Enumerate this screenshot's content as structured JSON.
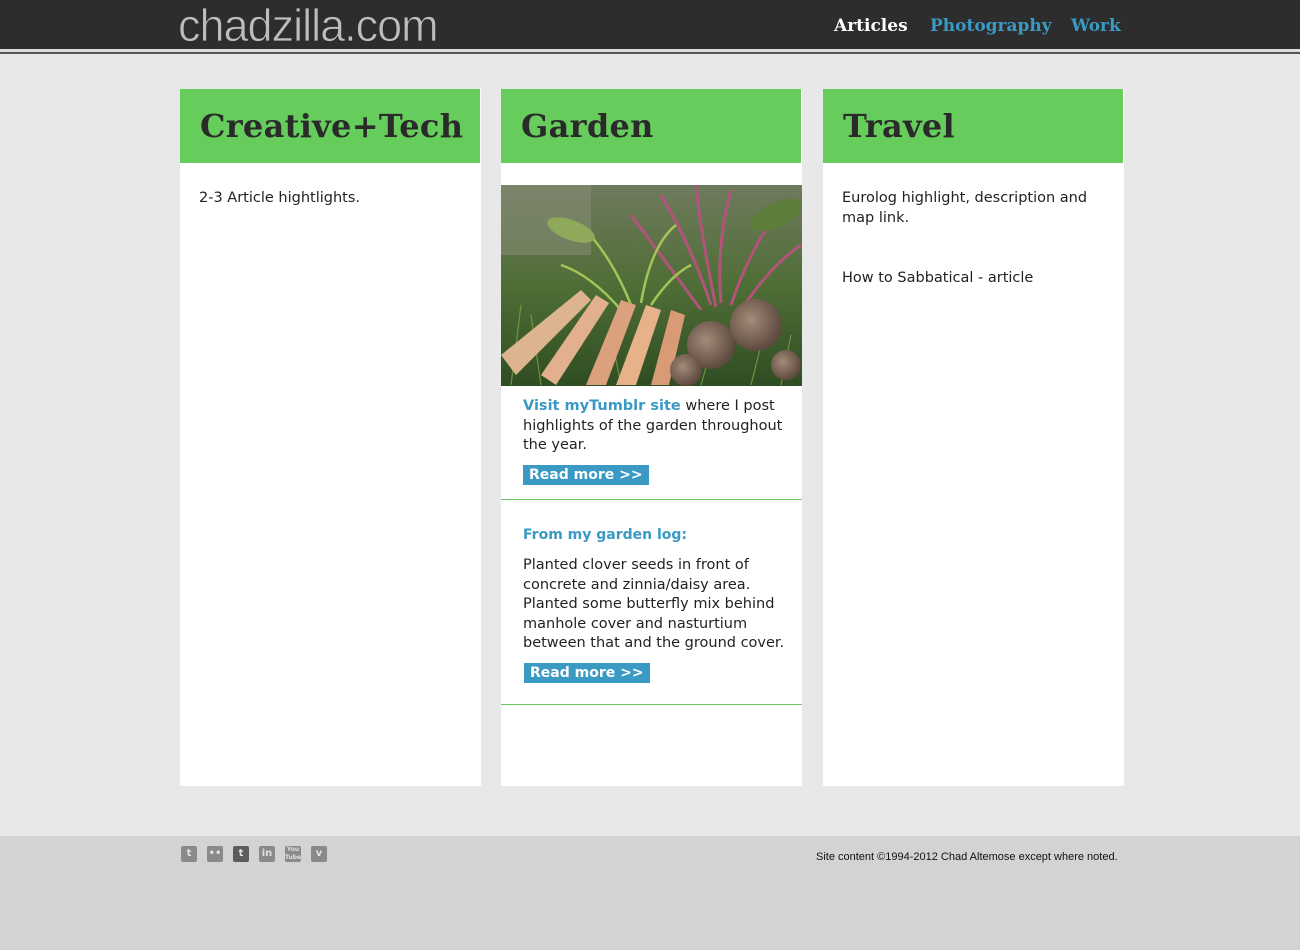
{
  "header": {
    "logo": "chadzilla.com",
    "nav": [
      "Articles",
      "Photography",
      "Work"
    ]
  },
  "columns": {
    "creative": {
      "title": "Creative+Tech",
      "text": "2-3 Article hightlights."
    },
    "garden": {
      "title": "Garden",
      "tumblr_link": "Visit myTumblr site",
      "tumblr_text": " where I post highlights of the garden throughout the year.",
      "read_more_1": "Read more >>",
      "log_heading": "From my garden log:",
      "log_text": "Planted clover seeds in front of concrete and zinnia/daisy area. Planted some butterfly mix behind manhole cover and nasturtium between that and the ground cover.",
      "read_more_2": "Read more >>"
    },
    "travel": {
      "title": "Travel",
      "text_1": "Eurolog highlight, description and map link.",
      "text_2": "How to Sabbatical - article"
    }
  },
  "footer": {
    "social_icons": [
      "twitter-icon",
      "flickr-icon",
      "tumblr-icon",
      "linkedin-icon",
      "youtube-icon",
      "vimeo-icon"
    ],
    "copyright": "Site content ©1994-2012 Chad Altemose except where noted."
  },
  "colors": {
    "header_bg": "#2d2d2d",
    "accent_green": "#66cc5c",
    "link_blue": "#3a9ac4",
    "page_bg": "#e8e8e8",
    "footer_bg": "#d3d3d3"
  }
}
